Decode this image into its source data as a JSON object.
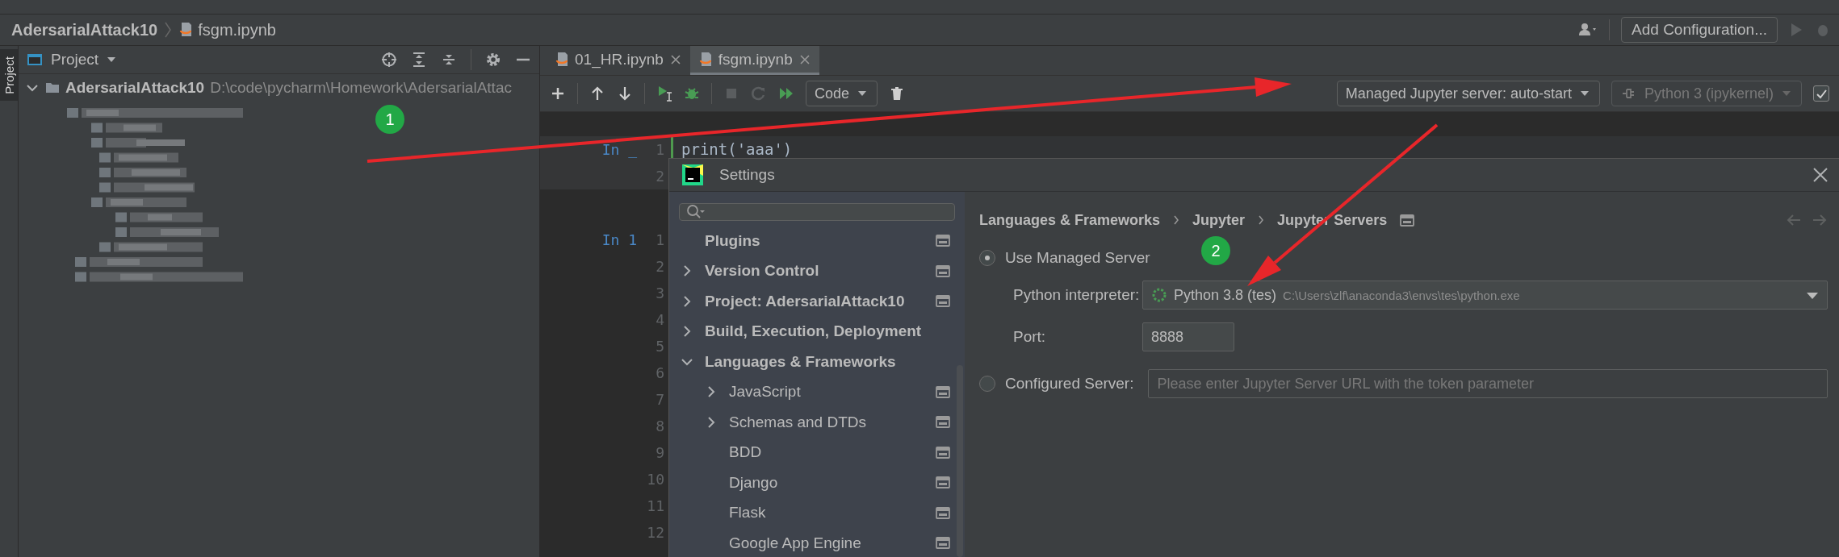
{
  "breadcrumb": [
    {
      "label": "AdersarialAttack10",
      "kind": "project"
    },
    {
      "label": "fsgm.ipynb",
      "kind": "file"
    }
  ],
  "run_config": {
    "label": "Add Configuration..."
  },
  "project_panel": {
    "tool_tab": "Project",
    "title": "Project",
    "root": {
      "name": "AdersarialAttack10",
      "path": "D:\\code\\pycharm\\Homework\\AdersarialAttac",
      "expanded": true
    }
  },
  "editor_tabs": [
    {
      "label": "01_HR.ipynb",
      "selected": false
    },
    {
      "label": "fsgm.ipynb",
      "selected": true
    }
  ],
  "notebook_toolbar": {
    "cell_type": "Code",
    "server": "Managed Jupyter server: auto-start",
    "kernel": {
      "label": "Python 3 (ipykernel)",
      "disabled": true
    },
    "checkbox": {
      "checked": true
    }
  },
  "cells": [
    {
      "prompt": "In _",
      "line_numbers": [
        "1",
        "2"
      ],
      "code": [
        "print('aaa')"
      ],
      "selected": true
    },
    {
      "prompt": "In 1",
      "line_numbers": [
        "1",
        "2",
        "3",
        "4",
        "5",
        "6",
        "7",
        "8",
        "9",
        "10",
        "11",
        "12"
      ],
      "selected": false
    }
  ],
  "settings": {
    "title": "Settings",
    "nav": [
      {
        "label": "Plugins",
        "scoped": true
      },
      {
        "label": "Version Control",
        "expanded": false,
        "scoped": true
      },
      {
        "label": "Project: AdersarialAttack10",
        "expanded": false,
        "scoped": true
      },
      {
        "label": "Build, Execution, Deployment",
        "expanded": false,
        "scoped": false
      },
      {
        "label": "Languages & Frameworks",
        "expanded": true,
        "scoped": false,
        "children": [
          {
            "label": "JavaScript",
            "expanded": false,
            "scoped": true
          },
          {
            "label": "Schemas and DTDs",
            "expanded": false,
            "scoped": true
          },
          {
            "label": "BDD",
            "scoped": true
          },
          {
            "label": "Django",
            "scoped": true
          },
          {
            "label": "Flask",
            "scoped": true
          },
          {
            "label": "Google App Engine",
            "scoped": true
          }
        ]
      }
    ],
    "path": [
      "Languages & Frameworks",
      "Jupyter",
      "Jupyter Servers"
    ],
    "options": [
      {
        "label": "Use Managed Server",
        "selected": true
      },
      {
        "label": "Configured Server:",
        "selected": false,
        "placeholder": "Please enter Jupyter Server URL with the token parameter"
      }
    ],
    "interpreter": {
      "label": "Python interpreter:",
      "name": "Python 3.8 (tes)",
      "path": "C:\\Users\\zlf\\anaconda3\\envs\\tes\\python.exe"
    },
    "port": {
      "label": "Port:",
      "value": "8888"
    }
  },
  "annotations": [
    {
      "number": "1"
    },
    {
      "number": "2"
    }
  ]
}
